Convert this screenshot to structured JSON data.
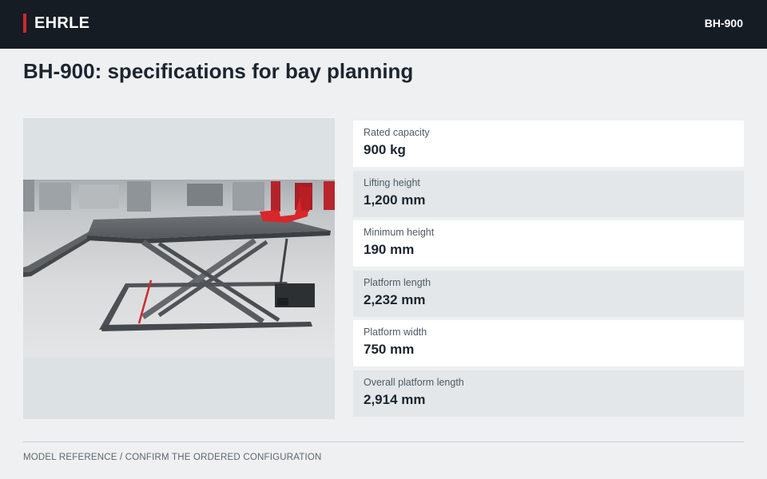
{
  "header": {
    "brand": "EHRLE",
    "model": "BH-900",
    "accent_color": "#d0282e",
    "background_color": "#151c24"
  },
  "page": {
    "title": "BH-900: specifications for bay planning"
  },
  "image": {
    "subject": "scissor-lift-platform",
    "alt": "BH-900"
  },
  "specs": [
    {
      "label": "Rated capacity",
      "value": "900 kg"
    },
    {
      "label": "Lifting height",
      "value": "1,200 mm"
    },
    {
      "label": "Minimum height",
      "value": "190 mm"
    },
    {
      "label": "Platform length",
      "value": "2,232 mm"
    },
    {
      "label": "Platform width",
      "value": "750 mm"
    },
    {
      "label": "Overall platform length",
      "value": "2,914 mm"
    }
  ],
  "footer": {
    "note": "MODEL REFERENCE / CONFIRM THE ORDERED CONFIGURATION"
  }
}
